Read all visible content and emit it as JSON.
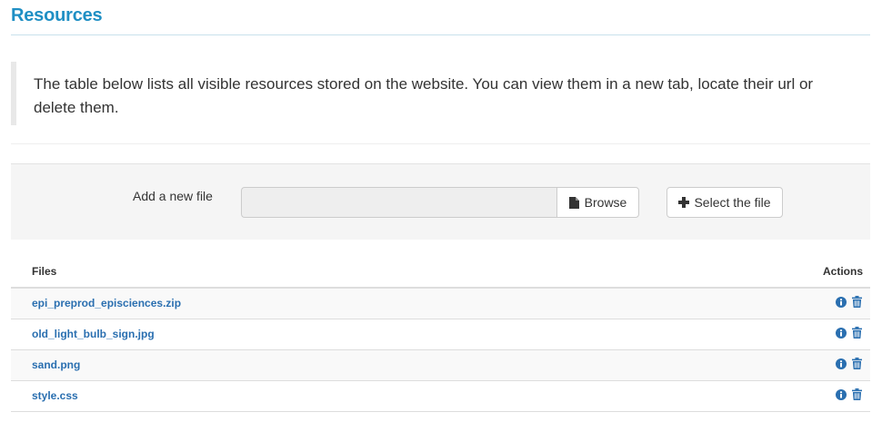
{
  "page": {
    "title": "Resources",
    "description": "The table below lists all visible resources stored on the website. You can view them in a new tab, locate their url or delete them."
  },
  "upload": {
    "label": "Add a new file",
    "file_value": "",
    "browse_label": "Browse",
    "browse_icon": "file-icon",
    "select_label": "Select the file",
    "select_icon": "plus-icon"
  },
  "table": {
    "headers": [
      "Files",
      "Actions"
    ],
    "rows": [
      {
        "name": "epi_preprod_episciences.zip"
      },
      {
        "name": "old_light_bulb_sign.jpg"
      },
      {
        "name": "sand.png"
      },
      {
        "name": "style.css"
      }
    ],
    "action_icons": [
      "info-icon",
      "trash-icon"
    ]
  },
  "colors": {
    "title": "#1f8fc4",
    "link": "#2a6fb0",
    "panel": "#f5f5f5",
    "icon": "#2a6fb0"
  }
}
